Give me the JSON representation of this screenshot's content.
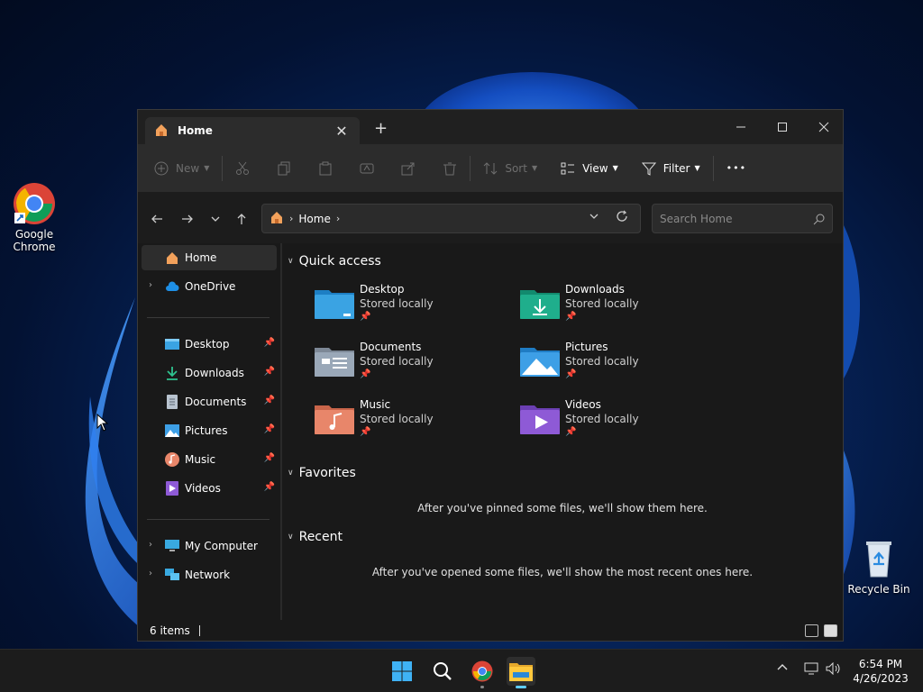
{
  "desktop": {
    "icons": [
      {
        "label": "Google\nChrome",
        "line1": "Google",
        "line2": "Chrome"
      },
      {
        "label": "Recycle Bin"
      }
    ]
  },
  "window": {
    "tab_title": "Home",
    "new_tab_glyph": "+",
    "close_tab_glyph": "✕"
  },
  "toolbar": {
    "new_label": "New",
    "sort_label": "Sort",
    "view_label": "View",
    "filter_label": "Filter",
    "more_glyph": "•••"
  },
  "address": {
    "crumb": "Home",
    "search_placeholder": "Search Home"
  },
  "sidebar": {
    "items": [
      {
        "label": "Home"
      },
      {
        "label": "OneDrive"
      },
      {
        "label": "Desktop"
      },
      {
        "label": "Downloads"
      },
      {
        "label": "Documents"
      },
      {
        "label": "Pictures"
      },
      {
        "label": "Music"
      },
      {
        "label": "Videos"
      },
      {
        "label": "My Computer"
      },
      {
        "label": "Network"
      }
    ]
  },
  "main": {
    "quick_access_title": "Quick access",
    "favorites_title": "Favorites",
    "recent_title": "Recent",
    "favorites_empty": "After you've pinned some files, we'll show them here.",
    "recent_empty": "After you've opened some files, we'll show the most recent ones here.",
    "quick_items": [
      {
        "name": "Desktop",
        "status": "Stored locally",
        "color": "#3aa3e3"
      },
      {
        "name": "Downloads",
        "status": "Stored locally",
        "color": "#1fae8c"
      },
      {
        "name": "Documents",
        "status": "Stored locally",
        "color": "#9aa8b8"
      },
      {
        "name": "Pictures",
        "status": "Stored locally",
        "color": "#3d9fe6"
      },
      {
        "name": "Music",
        "status": "Stored locally",
        "color": "#e8866a"
      },
      {
        "name": "Videos",
        "status": "Stored locally",
        "color": "#8e5ad6"
      }
    ]
  },
  "status": {
    "items_count": "6 items"
  },
  "taskbar": {
    "time": "6:54 PM",
    "date": "4/26/2023"
  },
  "colors": {
    "accent": "#60cdff",
    "window_bg": "#191919",
    "cmdbar_bg": "#2c2c2c"
  }
}
